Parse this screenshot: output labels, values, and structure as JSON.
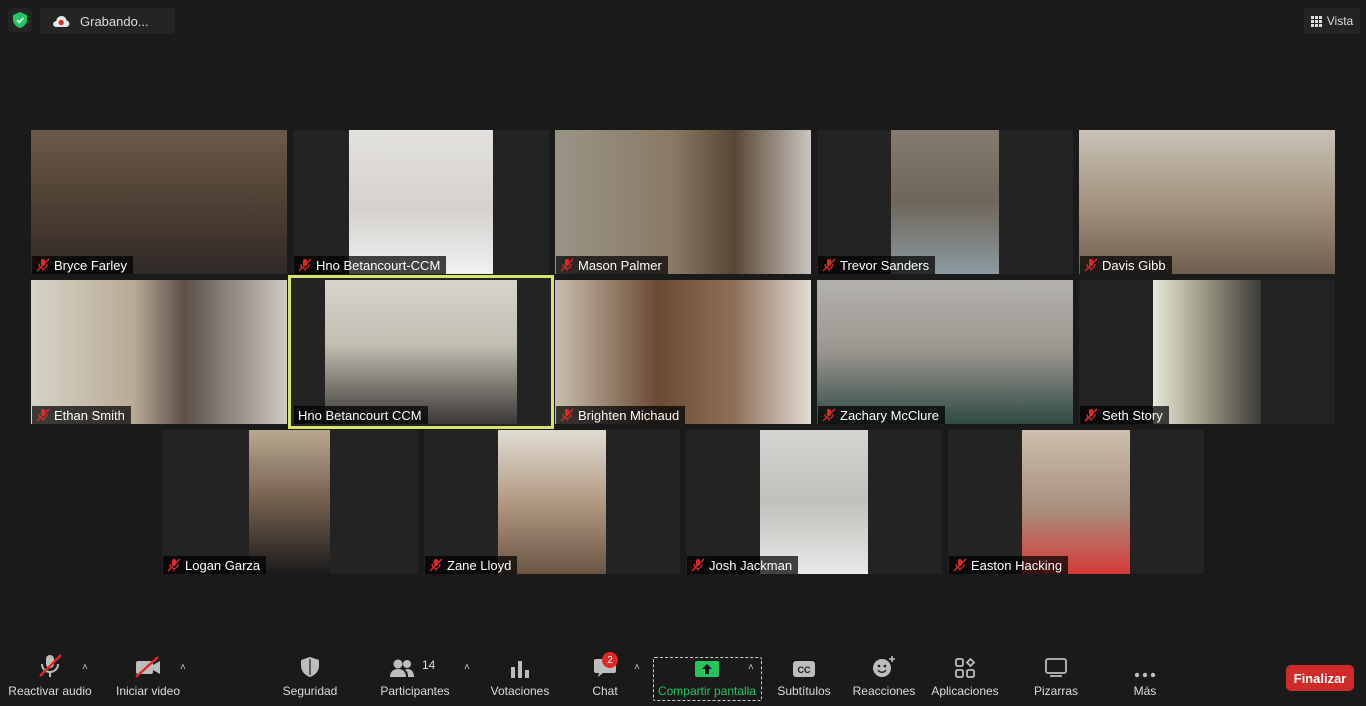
{
  "topbar": {
    "recording_label": "Grabando...",
    "view_label": "Vista"
  },
  "participants": [
    {
      "name": "Bryce Farley",
      "bg": "#5a4a3e"
    },
    {
      "name": "Hno Betancourt-CCM",
      "bg": "#d9d6d2"
    },
    {
      "name": "Mason Palmer",
      "bg": "#8a8172"
    },
    {
      "name": "Trevor Sanders",
      "bg": "#7d7468"
    },
    {
      "name": "Davis Gibb",
      "bg": "#a89c8c"
    },
    {
      "name": "Ethan Smith",
      "bg": "#b5b0a4"
    },
    {
      "name": "Hno Betancourt CCM",
      "bg": "#c9c4b8"
    },
    {
      "name": "Brighten Michaud",
      "bg": "#b3a38e"
    },
    {
      "name": "Zachary McClure",
      "bg": "#8f8b86"
    },
    {
      "name": "Seth Story",
      "bg": "#6c6a60"
    },
    {
      "name": "Logan Garza",
      "bg": "#6d5b4a"
    },
    {
      "name": "Zane Lloyd",
      "bg": "#a99884"
    },
    {
      "name": "Josh Jackman",
      "bg": "#c7c5c1"
    },
    {
      "name": "Easton Hacking",
      "bg": "#b79c8a"
    }
  ],
  "toolbar": {
    "unmute": "Reactivar audio",
    "start_video": "Iniciar video",
    "security": "Seguridad",
    "participants": "Participantes",
    "participants_count": "14",
    "polls": "Votaciones",
    "chat": "Chat",
    "chat_badge": "2",
    "share": "Compartir pantalla",
    "captions": "Subtítulos",
    "reactions": "Reacciones",
    "apps": "Aplicaciones",
    "whiteboards": "Pizarras",
    "more": "Más",
    "end": "Finalizar"
  },
  "colors": {
    "background": "#1a1a1a",
    "active_speaker": "#d7e56a",
    "end_button": "#d12a2a",
    "share_green": "#22c55e",
    "muted_red": "#e02828"
  }
}
